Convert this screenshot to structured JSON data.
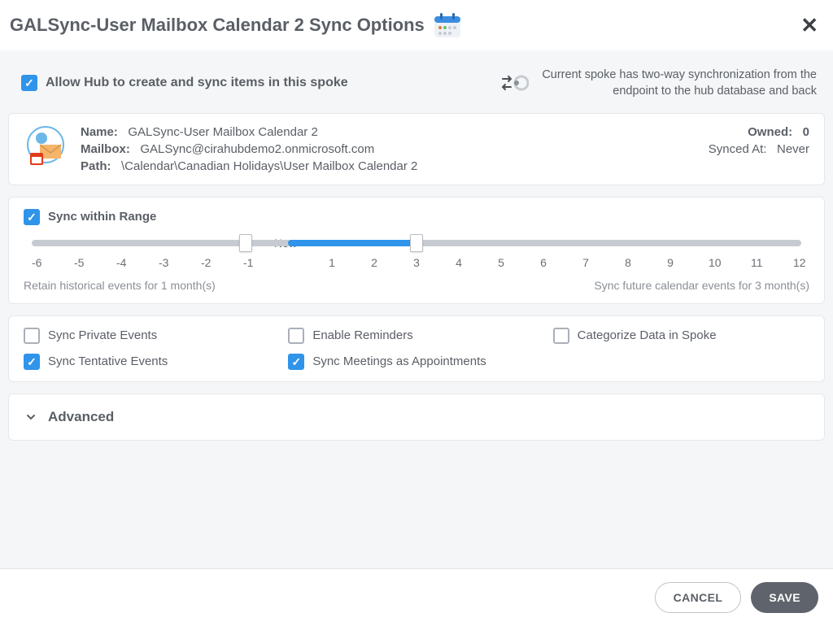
{
  "header": {
    "title": "GALSync-User Mailbox Calendar 2 Sync Options"
  },
  "allow": {
    "checked": true,
    "label": "Allow Hub to create and sync items in this spoke"
  },
  "sync_mode": {
    "description": "Current spoke has two-way synchronization from the endpoint to the hub database and back"
  },
  "info": {
    "name_label": "Name:",
    "name_value": "GALSync-User Mailbox Calendar 2",
    "mailbox_label": "Mailbox:",
    "mailbox_value": "GALSync@cirahubdemo2.onmicrosoft.com",
    "path_label": "Path:",
    "path_value": "\\Calendar\\Canadian Holidays\\User Mailbox Calendar 2",
    "owned_label": "Owned:",
    "owned_value": "0",
    "synced_label": "Synced At:",
    "synced_value": "Never"
  },
  "range": {
    "checked": true,
    "label": "Sync within Range",
    "now_label": "Now",
    "min": -6,
    "max": 12,
    "start": -1,
    "end": 3,
    "ticks": [
      "-6",
      "-5",
      "-4",
      "-3",
      "-2",
      "-1",
      "",
      "1",
      "2",
      "3",
      "4",
      "5",
      "6",
      "7",
      "8",
      "9",
      "10",
      "11",
      "12"
    ],
    "retain_text": "Retain historical events for 1 month(s)",
    "future_text": "Sync future calendar events for 3 month(s)"
  },
  "options": {
    "private_events": {
      "checked": false,
      "label": "Sync Private Events"
    },
    "tentative_events": {
      "checked": true,
      "label": "Sync Tentative Events"
    },
    "enable_reminders": {
      "checked": false,
      "label": "Enable Reminders"
    },
    "meetings_as_appointments": {
      "checked": true,
      "label": "Sync Meetings as Appointments"
    },
    "categorize_data": {
      "checked": false,
      "label": "Categorize Data in Spoke"
    }
  },
  "advanced": {
    "label": "Advanced"
  },
  "footer": {
    "cancel": "CANCEL",
    "save": "SAVE"
  }
}
